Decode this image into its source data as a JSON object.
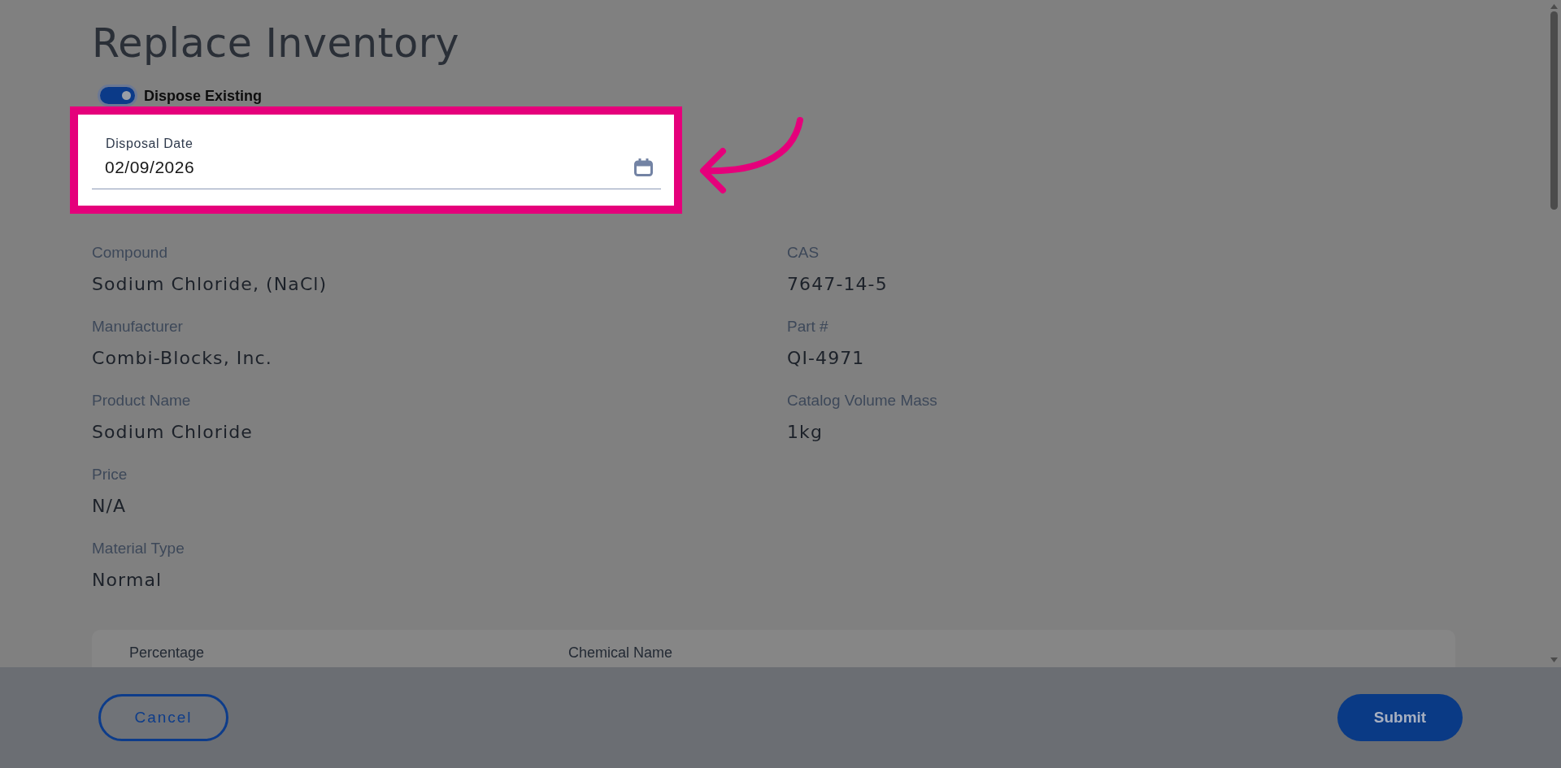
{
  "page": {
    "title": "Replace Inventory"
  },
  "dispose_toggle": {
    "label": "Dispose Existing",
    "on": true
  },
  "disposal_date": {
    "label": "Disposal Date",
    "value": "02/09/2026",
    "highlighted": true
  },
  "details": {
    "left": [
      {
        "label": "Compound",
        "value": "Sodium Chloride, (NaCl)"
      },
      {
        "label": "Manufacturer",
        "value": "Combi-Blocks, Inc."
      },
      {
        "label": "Product Name",
        "value": "Sodium Chloride"
      },
      {
        "label": "Price",
        "value": "N/A"
      },
      {
        "label": "Material Type",
        "value": "Normal"
      }
    ],
    "right": [
      {
        "label": "CAS",
        "value": "7647-14-5"
      },
      {
        "label": "Part #",
        "value": "QI-4971"
      },
      {
        "label": "Catalog Volume Mass",
        "value": "1kg"
      }
    ]
  },
  "components_table": {
    "columns": [
      "Percentage",
      "Chemical Name"
    ]
  },
  "footer": {
    "buttons": [
      {
        "label": "Cancel",
        "kind": "outline"
      },
      {
        "label": "Submit",
        "kind": "primary"
      }
    ]
  }
}
